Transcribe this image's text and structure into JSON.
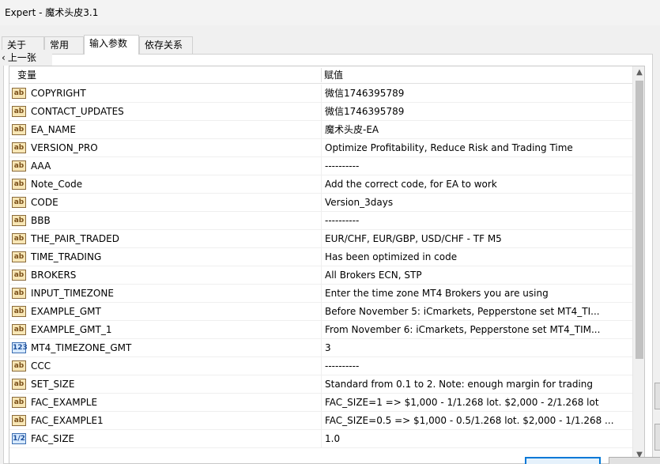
{
  "window": {
    "title": "Expert - 魔术头皮3.1"
  },
  "tabs": [
    {
      "label": "关于"
    },
    {
      "label": "常用"
    },
    {
      "label": "输入参数"
    },
    {
      "label": "依存关系"
    }
  ],
  "back_link": {
    "label": "上一张"
  },
  "table": {
    "headers": {
      "variable": "变量",
      "value": "赋值"
    },
    "rows": [
      {
        "icon": "ab",
        "name": "COPYRIGHT",
        "value": "微信1746395789"
      },
      {
        "icon": "ab",
        "name": "CONTACT_UPDATES",
        "value": "微信1746395789"
      },
      {
        "icon": "ab",
        "name": "EA_NAME",
        "value": "魔术头皮-EA"
      },
      {
        "icon": "ab",
        "name": "VERSION_PRO",
        "value": "Optimize Profitability, Reduce Risk and Trading Time"
      },
      {
        "icon": "ab",
        "name": "AAA",
        "value": "----------"
      },
      {
        "icon": "ab",
        "name": "Note_Code",
        "value": "Add the correct code, for EA to work"
      },
      {
        "icon": "ab",
        "name": "CODE",
        "value": "Version_3days"
      },
      {
        "icon": "ab",
        "name": "BBB",
        "value": "----------"
      },
      {
        "icon": "ab",
        "name": "THE_PAIR_TRADED",
        "value": "EUR/CHF, EUR/GBP, USD/CHF - TF M5"
      },
      {
        "icon": "ab",
        "name": "TIME_TRADING",
        "value": "Has been optimized in code"
      },
      {
        "icon": "ab",
        "name": "BROKERS",
        "value": "All Brokers ECN, STP"
      },
      {
        "icon": "ab",
        "name": "INPUT_TIMEZONE",
        "value": "Enter the time zone MT4 Brokers you are using"
      },
      {
        "icon": "ab",
        "name": "EXAMPLE_GMT",
        "value": "Before November 5: iCmarkets, Pepperstone set MT4_TI..."
      },
      {
        "icon": "ab",
        "name": "EXAMPLE_GMT_1",
        "value": "From November 6: iCmarkets, Pepperstone set MT4_TIM..."
      },
      {
        "icon": "123",
        "name": "MT4_TIMEZONE_GMT",
        "value": "3"
      },
      {
        "icon": "ab",
        "name": "CCC",
        "value": "----------"
      },
      {
        "icon": "ab",
        "name": "SET_SIZE",
        "value": "Standard from 0.1 to 2. Note: enough margin for trading"
      },
      {
        "icon": "ab",
        "name": "FAC_EXAMPLE",
        "value": "FAC_SIZE=1 => $1,000 - 1/1.268 lot. $2,000 - 2/1.268 lot"
      },
      {
        "icon": "ab",
        "name": "FAC_EXAMPLE1",
        "value": "FAC_SIZE=0.5 => $1,000 - 0.5/1.268 lot. $2,000 - 1/1.268 ..."
      },
      {
        "icon": "1/2",
        "name": "FAC_SIZE",
        "value": "1.0"
      }
    ]
  },
  "scrollbar": {
    "up": "▲",
    "down": "▼"
  }
}
